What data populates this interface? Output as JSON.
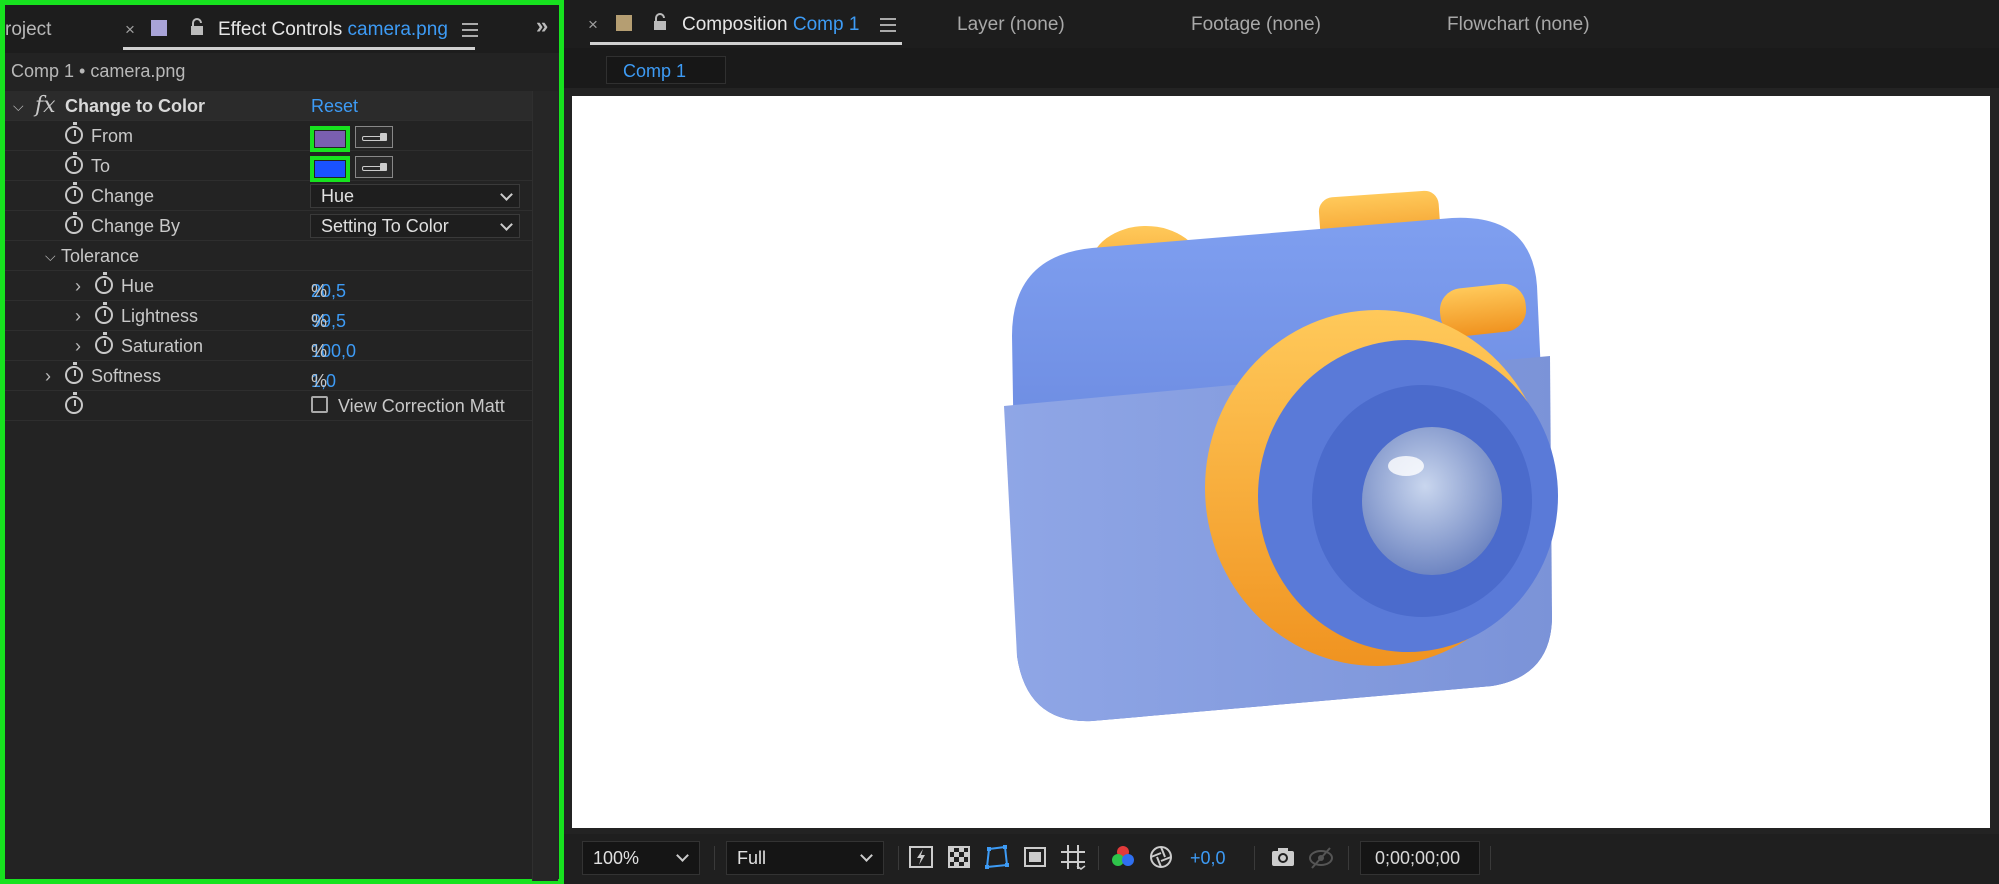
{
  "left_panel": {
    "tab_project": "roject",
    "tab_close": "×",
    "tab_title": "Effect Controls",
    "tab_title_file": "camera.png",
    "overflow_glyph": "»",
    "comp_label": "Comp 1 • camera.png",
    "effect": {
      "fx_glyph": "fx",
      "name": "Change to Color",
      "reset": "Reset",
      "from_label": "From",
      "from_color": "#7a5fb0",
      "to_label": "To",
      "to_color": "#1a52ff",
      "change_label": "Change",
      "change_value": "Hue",
      "change_by_label": "Change By",
      "change_by_value": "Setting To Color",
      "tolerance_label": "Tolerance",
      "hue_label": "Hue",
      "hue_value": "20,5",
      "lightness_label": "Lightness",
      "lightness_value": "99,5",
      "saturation_label": "Saturation",
      "saturation_value": "100,0",
      "softness_label": "Softness",
      "softness_value": "1,0",
      "percent": "%",
      "view_correction_label": "View Correction Matt"
    }
  },
  "right_panel": {
    "tab_close": "×",
    "tab_composition": "Composition",
    "tab_composition_name": "Comp 1",
    "tab_layer": "Layer (none)",
    "tab_footage": "Footage (none)",
    "tab_flowchart": "Flowchart (none)",
    "subtab": "Comp 1",
    "zoom": "100%",
    "resolution": "Full",
    "exposure": "+0,0",
    "timecode": "0;00;00;00"
  },
  "colors": {
    "accent_blue": "#3d9bf5",
    "highlight_green": "#17e21f",
    "camera_body": "#6f8fe0",
    "camera_orange": "#f5a52a"
  }
}
